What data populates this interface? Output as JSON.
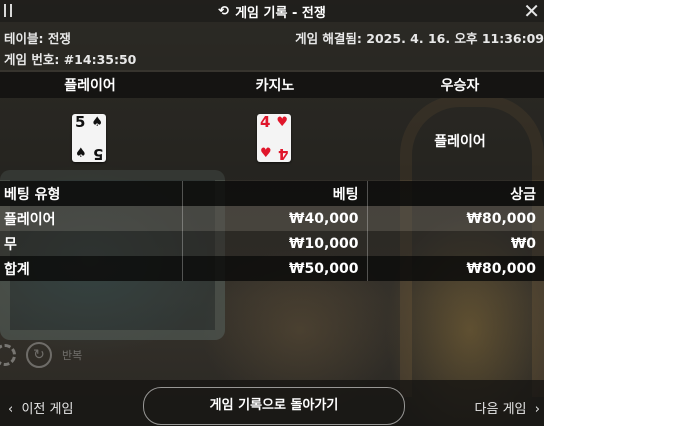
{
  "window": {
    "title": "게임 기록 - 전쟁"
  },
  "info": {
    "table_label": "테이블: 전쟁",
    "game_number": "게임 번호: #14:35:50",
    "resolved": "게임 해결됨: 2025. 4. 16. 오후 11:36:09"
  },
  "result": {
    "headers": [
      "플레이어",
      "카지노",
      "우승자"
    ],
    "player_card": {
      "rank": "5",
      "suit": "♠",
      "color": "#111111"
    },
    "casino_card": {
      "rank": "4",
      "suit": "♥",
      "color": "#e0162b"
    },
    "winner": "플레이어"
  },
  "bets": {
    "columns": [
      "베팅 유형",
      "베팅",
      "상금"
    ],
    "rows": [
      {
        "type": "플레이어",
        "bet": "₩40,000",
        "payout": "₩80,000"
      },
      {
        "type": "무",
        "bet": "₩10,000",
        "payout": "₩0"
      },
      {
        "type": "합계",
        "bet": "₩50,000",
        "payout": "₩80,000"
      }
    ]
  },
  "repeat_label": "반복",
  "footer": {
    "prev_label": "이전 게임",
    "back_label": "게임 기록으로 돌아가기",
    "next_label": "다음 게임"
  }
}
